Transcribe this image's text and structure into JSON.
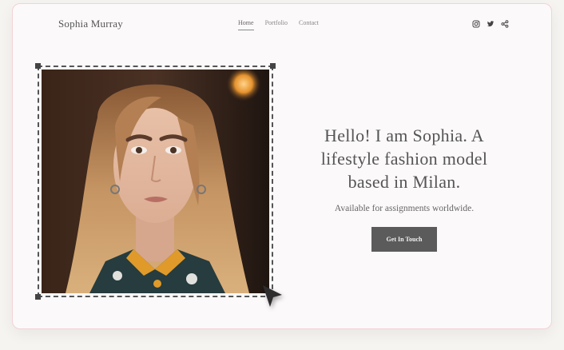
{
  "brand": {
    "name": "Sophia Murray"
  },
  "nav": {
    "items": [
      {
        "label": "Home",
        "active": true
      },
      {
        "label": "Portfolio",
        "active": false
      },
      {
        "label": "Contact",
        "active": false
      }
    ]
  },
  "social": {
    "icons": [
      "instagram-icon",
      "twitter-icon",
      "share-icon"
    ]
  },
  "hero": {
    "heading": "Hello! I am Sophia. A lifestyle fashion model based in Milan.",
    "subtitle": "Available for assignments worldwide.",
    "cta_label": "Get In Touch"
  },
  "colors": {
    "page_bg": "#f6f4f1",
    "card_bg": "#fcf9fa",
    "card_border": "#f1d3d6",
    "button_bg": "#5b5b5b",
    "text": "#555555"
  }
}
